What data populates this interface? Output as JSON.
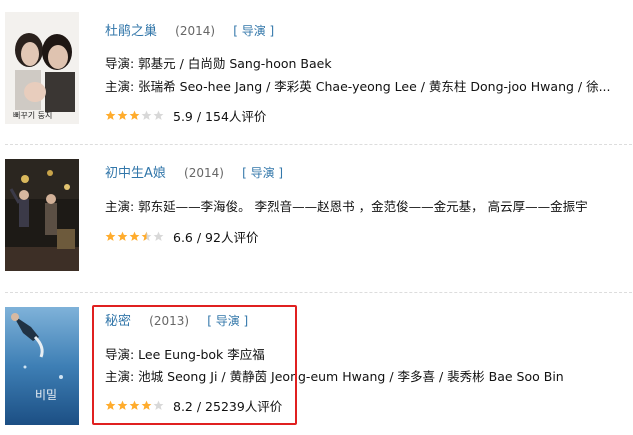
{
  "colors": {
    "link": "#3377aa",
    "star_on": "#ffac2d",
    "star_off": "#d8d8d8",
    "highlight": "#e02020"
  },
  "items": [
    {
      "title": "杜鹃之巢",
      "year": "(2014)",
      "role": "[ 导演 ]",
      "lines": [
        "导演: 郭基元 / 白尚勋 Sang-hoon Baek",
        "主演: 张瑞希 Seo-hee Jang / 李彩英 Chae-yeong Lee / 黄东柱 Dong-joo Hwang / 徐..."
      ],
      "stars": 3,
      "rating": "5.9 / 154人评价",
      "poster_text": "뻐꾸기 둥지"
    },
    {
      "title": "初中生A娘",
      "year": "(2014)",
      "role": "[ 导演 ]",
      "lines": [
        "主演: 郭东延——李海俊。 李烈音——赵恩书 ，金范俊——金元基， 高云厚——金振宇"
      ],
      "stars": 3.5,
      "rating": "6.6 / 92人评价"
    },
    {
      "title": "秘密",
      "year": "(2013)",
      "role": "[ 导演 ]",
      "lines": [
        "导演: Lee Eung-bok 李应福",
        "主演: 池城 Seong Ji / 黄静茵 Jeong-eum Hwang / 李多喜 / 裴秀彬 Bae Soo Bin"
      ],
      "stars": 4,
      "rating": "8.2 / 25239人评价",
      "poster_text": "비밀"
    }
  ]
}
